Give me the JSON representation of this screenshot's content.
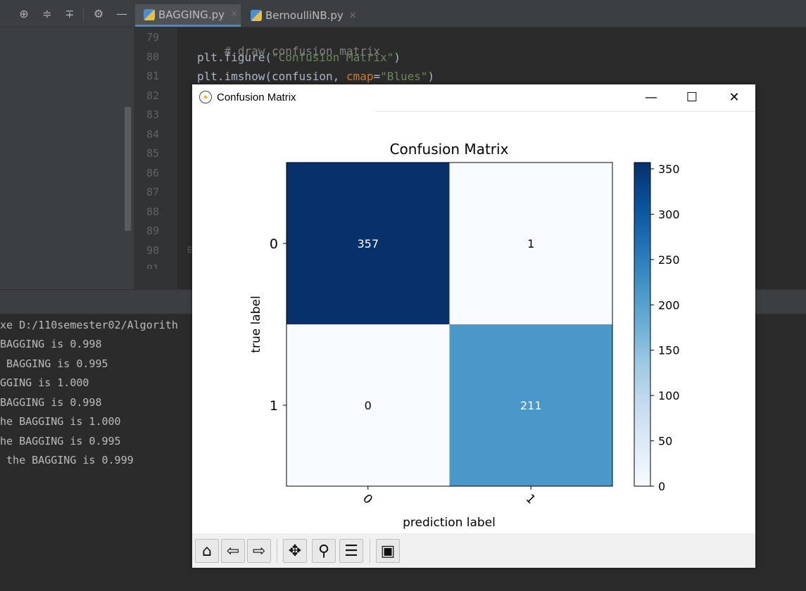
{
  "ide": {
    "tabs": [
      {
        "label": "BAGGING.py",
        "active": true
      },
      {
        "label": "BernoulliNB.py",
        "active": false
      }
    ],
    "toolbar_icons": [
      "crosshair-icon",
      "expand-all-icon",
      "collapse-all-icon",
      "gear-icon",
      "minimize-icon"
    ],
    "line_numbers": [
      "79",
      "80",
      "81",
      "82",
      "83",
      "84",
      "85",
      "86",
      "87",
      "88",
      "89",
      "90",
      "91"
    ],
    "code": {
      "line79": "# draw confusion matrix",
      "line80_fn": "plt.figure(",
      "line80_str": "\"Confusion Matrix\"",
      "line80_end": ")",
      "line81_fn": "plt.imshow(confusion, ",
      "line81_kw": "cmap",
      "line81_eq": "=",
      "line81_str": "\"Blues\"",
      "line81_end": ")"
    },
    "run_output": [
      "xe D:/110semester02/Algorith",
      "BAGGING is 0.998",
      " BAGGING is 0.995",
      "GGING is 1.000",
      "BAGGING is 0.998",
      "he BAGGING is 1.000",
      "he BAGGING is 0.995",
      " the BAGGING is 0.999"
    ]
  },
  "plot_window": {
    "title": "Confusion Matrix",
    "controls": [
      "minimize-icon",
      "maximize-icon",
      "close-icon"
    ],
    "toolbar": [
      "home-icon",
      "back-icon",
      "forward-icon",
      "pan-icon",
      "zoom-icon",
      "configure-subplots-icon",
      "save-icon"
    ]
  },
  "chart_data": {
    "type": "heatmap",
    "title": "Confusion Matrix",
    "xlabel": "prediction label",
    "ylabel": "true label",
    "x_categories": [
      "0",
      "1"
    ],
    "y_categories": [
      "0",
      "1"
    ],
    "values": [
      [
        357,
        1
      ],
      [
        0,
        211
      ]
    ],
    "colormap": "Blues",
    "cell_colors": [
      [
        "#08306b",
        "#f7fbff"
      ],
      [
        "#f7fbff",
        "#4a98c9"
      ]
    ],
    "colorbar": {
      "min": 0,
      "max": 357,
      "ticks": [
        0,
        50,
        100,
        150,
        200,
        250,
        300,
        350
      ]
    },
    "xtick_rotation_deg": -45
  }
}
